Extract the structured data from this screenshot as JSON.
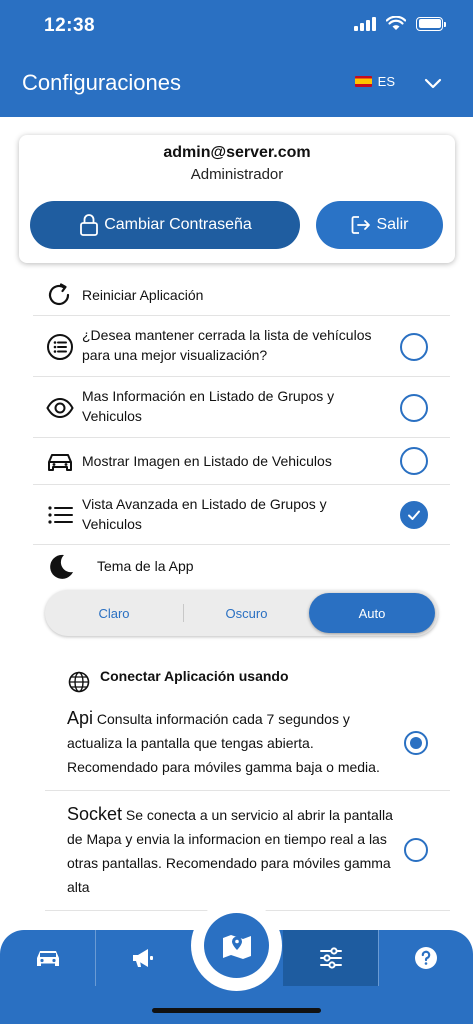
{
  "status": {
    "time": "12:38"
  },
  "header": {
    "title": "Configuraciones",
    "language_code": "ES"
  },
  "account": {
    "email": "admin@server.com",
    "role": "Administrador",
    "change_password_label": "Cambiar Contraseña",
    "logout_label": "Salir"
  },
  "settings": {
    "restart_label": "Reiniciar Aplicación",
    "collapse_list_label": "¿Desea mantener cerrada la lista de vehículos para una mejor visualización?",
    "collapse_list_checked": false,
    "more_info_label": "Mas Información en Listado de Grupos y Vehiculos",
    "more_info_checked": false,
    "show_image_label": "Mostrar Imagen en Listado de Vehiculos",
    "show_image_checked": false,
    "advanced_view_label": "Vista Avanzada en Listado de Grupos y Vehiculos",
    "advanced_view_checked": true
  },
  "theme": {
    "label": "Tema de la App",
    "options": [
      "Claro",
      "Oscuro",
      "Auto"
    ],
    "selected": "Auto"
  },
  "connection": {
    "title": "Conectar Aplicación usando",
    "api": {
      "name": "Api",
      "description": "Consulta información cada 7 segundos y actualiza la pantalla que tengas abierta. Recomendado para móviles gamma baja o media.",
      "selected": true
    },
    "socket": {
      "name": "Socket",
      "description": "Se conecta a un servicio al abrir la pantalla de Mapa y envia la informacion en tiempo real a las otras pantallas. Recomendado para móviles gamma alta",
      "selected": false
    }
  },
  "nav": {
    "items": [
      "car-icon",
      "megaphone-icon",
      "map-icon",
      "sliders-icon",
      "help-icon"
    ],
    "active": "sliders-icon"
  },
  "colors": {
    "primary": "#2a70c2",
    "primary_dark": "#1f5da0"
  }
}
